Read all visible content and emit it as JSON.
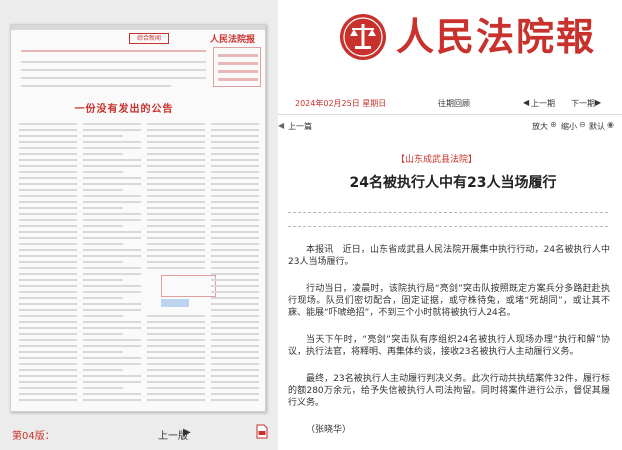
{
  "masthead": {
    "paper_name": "人民法院報"
  },
  "date_bar": {
    "date": "2024年02月25日 星期日",
    "past_review": "往期回顾",
    "prev_issue": "上一期",
    "next_issue": "下一期",
    "prev_arrow": "◀",
    "next_arrow": "▶"
  },
  "article_tools": {
    "prev_article": "上一篇",
    "prev_arrow": "◀",
    "zoom_in": "放大",
    "zoom_out": "缩小",
    "default_size": "默认"
  },
  "article": {
    "source": "【山东成武县法院】",
    "title": "24名被执行人中有23人当场履行",
    "paragraphs": [
      "本报讯　近日，山东省成武县人民法院开展集中执行行动，24名被执行人中23人当场履行。",
      "行动当日，凌晨时，该院执行局“亮剑”突击队按照既定方案兵分多路赶赴执行现场。队员们密切配合，固定证据，或守株待兔，或堵“死胡同”，或让其不寐、能展“吓唬绝招”，不到三个小时就将被执行人24名。",
      "当天下午时，“亮剑”突击队有序组织24名被执行人现场办理“执行和解”协议，执行法官，将释明、再集体约谈，接收23名被执行人主动履行义务。",
      "最终，23名被执行人主动履行判决义务。此次行动共执结案件32件，履行标的额280万余元，给予失信被执行人司法拘留。同时将案件进行公示，督促其履行义务。"
    ],
    "byline": "（张晓华）"
  },
  "page_footer": {
    "page_number": "第04版：",
    "prev_page": "上一版",
    "prev_page_arrow": "▶"
  },
  "thumbnail": {
    "headline": "一份没有发出的公告",
    "masthead_label": "综合新闻",
    "logo": "人民法院报"
  },
  "colors": {
    "brand_red": "#c9312c",
    "link_blue": "#bcd4ef"
  }
}
